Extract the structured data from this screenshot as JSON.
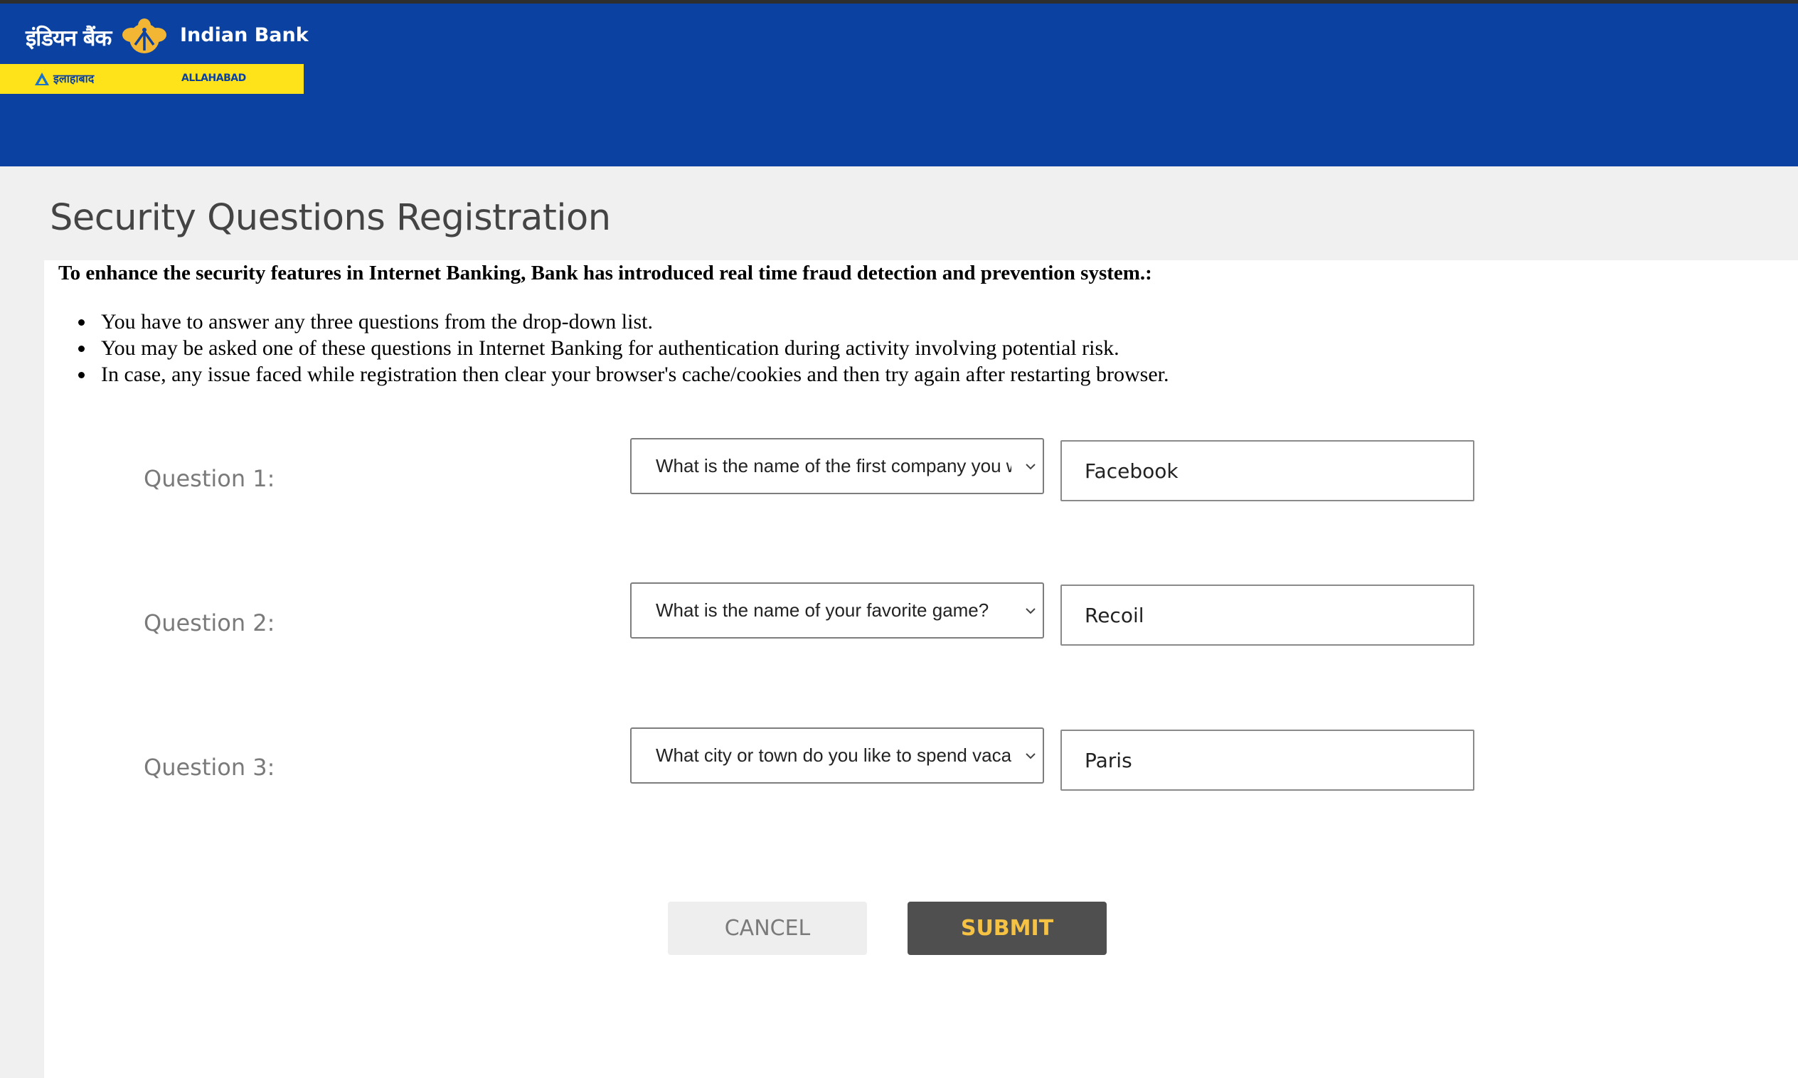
{
  "header": {
    "logo_hindi": "इंडियन बैंक",
    "logo_english": "Indian Bank",
    "logo_sub_hindi": "इलाहाबाद",
    "logo_sub_english": "ALLAHABAD",
    "brand_color": "#0b41a0",
    "accent_color": "#ffe31a",
    "emblem_icon": "indian-bank-emblem-icon"
  },
  "page": {
    "title": "Security Questions Registration",
    "intro": "To enhance the security features in Internet Banking, Bank has introduced real time fraud detection and prevention system.:",
    "bullets": [
      "You have to answer any three questions from the drop-down list.",
      "You may be asked one of these questions in Internet Banking for authentication during activity involving potential risk.",
      "In case, any issue faced while registration then clear your browser's cache/cookies and then try again after restarting browser."
    ]
  },
  "questions": [
    {
      "label": "Question 1:",
      "selected": "What is the name of the first company you worked for?",
      "answer": "Facebook"
    },
    {
      "label": "Question 2:",
      "selected": "What is the name of your favorite game?",
      "answer": "Recoil"
    },
    {
      "label": "Question 3:",
      "selected": "What city or town do you like to spend vacation in?",
      "answer": "Paris"
    }
  ],
  "buttons": {
    "cancel": "CANCEL",
    "submit": "SUBMIT"
  }
}
